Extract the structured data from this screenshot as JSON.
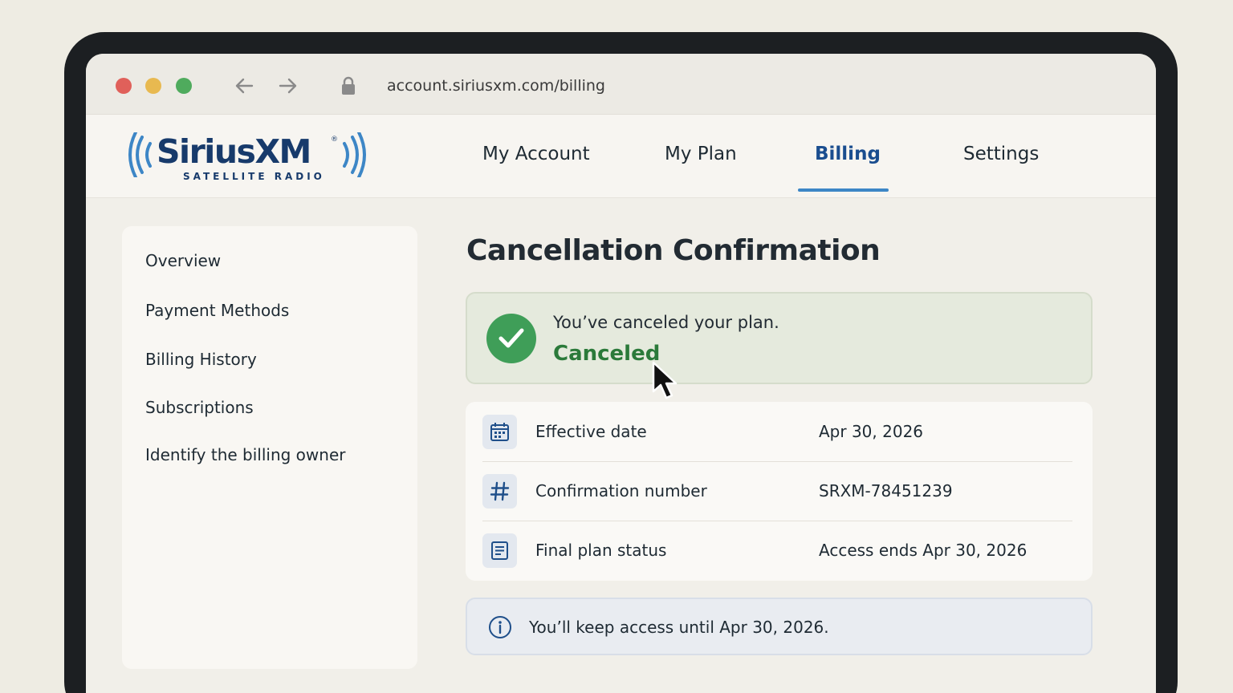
{
  "browser": {
    "url": "account.siriusxm.com/billing"
  },
  "brand": {
    "name": "SiriusXM",
    "registered_mark": "®",
    "tagline": "SATELLITE RADIO",
    "primary_color": "#173a6b",
    "accent_color": "#3d86c6"
  },
  "topnav": {
    "items": [
      {
        "label": "My Account"
      },
      {
        "label": "My Plan"
      },
      {
        "label": "Billing",
        "active": true
      },
      {
        "label": "Settings"
      }
    ]
  },
  "sidebar": {
    "items": [
      {
        "label": "Overview"
      },
      {
        "label": "Payment Methods"
      },
      {
        "label": "Billing History"
      },
      {
        "label": "Subscriptions"
      },
      {
        "label": "Identify the billing owner"
      }
    ]
  },
  "main": {
    "title": "Cancellation Confirmation",
    "success": {
      "message": "You’ve canceled your plan.",
      "status": "Canceled",
      "icon": "check-circle-icon",
      "color": "#3f9e58"
    },
    "details": [
      {
        "icon": "calendar-icon",
        "label": "Effective date",
        "value": "Apr 30, 2026"
      },
      {
        "icon": "hash-icon",
        "label": "Confirmation number",
        "value": "SRXM-78451239"
      },
      {
        "icon": "document-icon",
        "label": "Final plan status",
        "value": "Access ends Apr 30, 2026"
      }
    ],
    "info": {
      "icon": "info-icon",
      "text": "You’ll keep access until Apr 30, 2026."
    }
  }
}
